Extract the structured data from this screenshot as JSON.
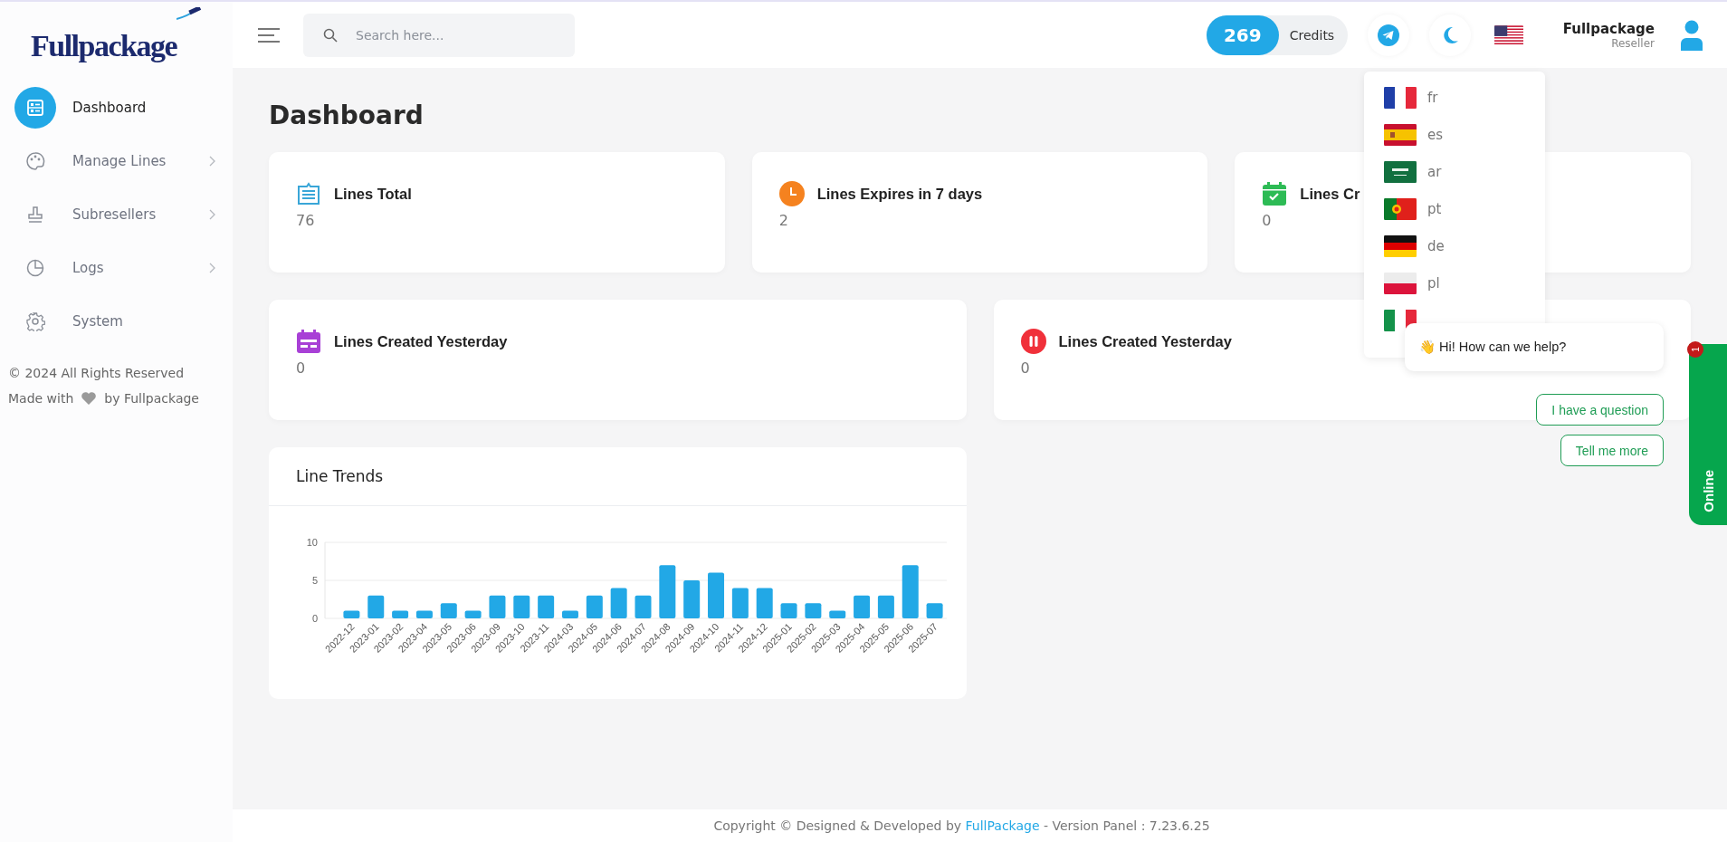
{
  "logo": {
    "text": "Fullpackage"
  },
  "sidebar": {
    "items": [
      {
        "label": "Dashboard",
        "kind": "dashboard",
        "selected": true,
        "has_submenu": false
      },
      {
        "label": "Manage Lines",
        "kind": "palette",
        "selected": false,
        "has_submenu": true
      },
      {
        "label": "Subresellers",
        "kind": "stamp",
        "selected": false,
        "has_submenu": true
      },
      {
        "label": "Logs",
        "kind": "pie",
        "selected": false,
        "has_submenu": true
      },
      {
        "label": "System",
        "kind": "gear",
        "selected": false,
        "has_submenu": false
      }
    ],
    "copyright": "© 2024 All Rights Reserved",
    "made_with": "Made with",
    "made_by": "by Fullpackage"
  },
  "header": {
    "search": {
      "placeholder": "Search here..."
    },
    "credits": {
      "amount": "269",
      "label": "Credits"
    },
    "language": {
      "kind": "us"
    },
    "user": {
      "name": "Fullpackage",
      "role": "Reseller"
    }
  },
  "page_title": "Dashboard",
  "stat_cards": [
    {
      "title": "Lines Total",
      "value": "76",
      "kind": "list"
    },
    {
      "title": "Lines Expires in 7 days",
      "value": "2",
      "kind": "clock"
    },
    {
      "title": "Lines Cr",
      "value": "0",
      "kind": "calendar-check"
    }
  ],
  "stat_cards_row2": [
    {
      "title": "Lines Created Yesterday",
      "value": "0",
      "kind": "calendar"
    },
    {
      "title": "Lines Created Yesterday",
      "value": "0",
      "kind": "pause"
    }
  ],
  "line_trends": {
    "title": "Line Trends",
    "chart_data": {
      "type": "bar",
      "categories": [
        "2022-12",
        "2023-01",
        "2023-02",
        "2023-04",
        "2023-05",
        "2023-06",
        "2023-09",
        "2023-10",
        "2023-11",
        "2024-03",
        "2024-05",
        "2024-06",
        "2024-07",
        "2024-08",
        "2024-09",
        "2024-10",
        "2024-11",
        "2024-12",
        "2025-01",
        "2025-02",
        "2025-03",
        "2025-04",
        "2025-05",
        "2025-06",
        "2025-07"
      ],
      "series": [
        {
          "color": "#22a8e6",
          "values": [
            1,
            3,
            1,
            1,
            2,
            1,
            3,
            3,
            3,
            1,
            3,
            4,
            3,
            7,
            5,
            6,
            4,
            4,
            2,
            2,
            1,
            3,
            3,
            7,
            2
          ]
        }
      ],
      "ylim": [
        0,
        10
      ],
      "yticks": [
        0,
        5,
        10
      ]
    }
  },
  "language_menu": [
    {
      "kind": "fr",
      "label": "fr"
    },
    {
      "kind": "es",
      "label": "es"
    },
    {
      "kind": "ar",
      "label": "ar"
    },
    {
      "kind": "pt",
      "label": "pt"
    },
    {
      "kind": "de",
      "label": "de"
    },
    {
      "kind": "pl",
      "label": "pl"
    },
    {
      "kind": "it"
    }
  ],
  "chat": {
    "greeting": "👋 Hi! How can we help?",
    "buttons": [
      "I have a question",
      "Tell me more"
    ],
    "tab_label": "Online",
    "badge": "1"
  },
  "footer": {
    "prefix": "Copyright © Designed & Developed by ",
    "link": "FullPackage",
    "suffix": " - Version Panel : 7.23.6.25"
  }
}
